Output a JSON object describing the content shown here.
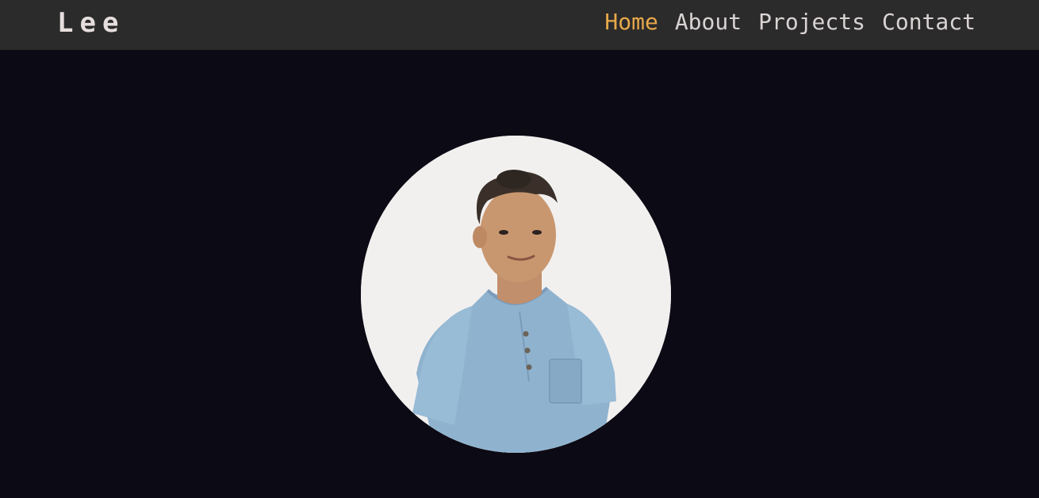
{
  "nav": {
    "brand": "Lee",
    "links": [
      {
        "label": "Home",
        "active": true
      },
      {
        "label": "About",
        "active": false
      },
      {
        "label": "Projects",
        "active": false
      },
      {
        "label": "Contact",
        "active": false
      }
    ]
  },
  "hero": {
    "avatar_description": "portrait-photo"
  },
  "colors": {
    "background": "#0c0a14",
    "navbar": "#2c2b2b",
    "accent": "#e8a94a",
    "text": "#d9d3d3"
  }
}
